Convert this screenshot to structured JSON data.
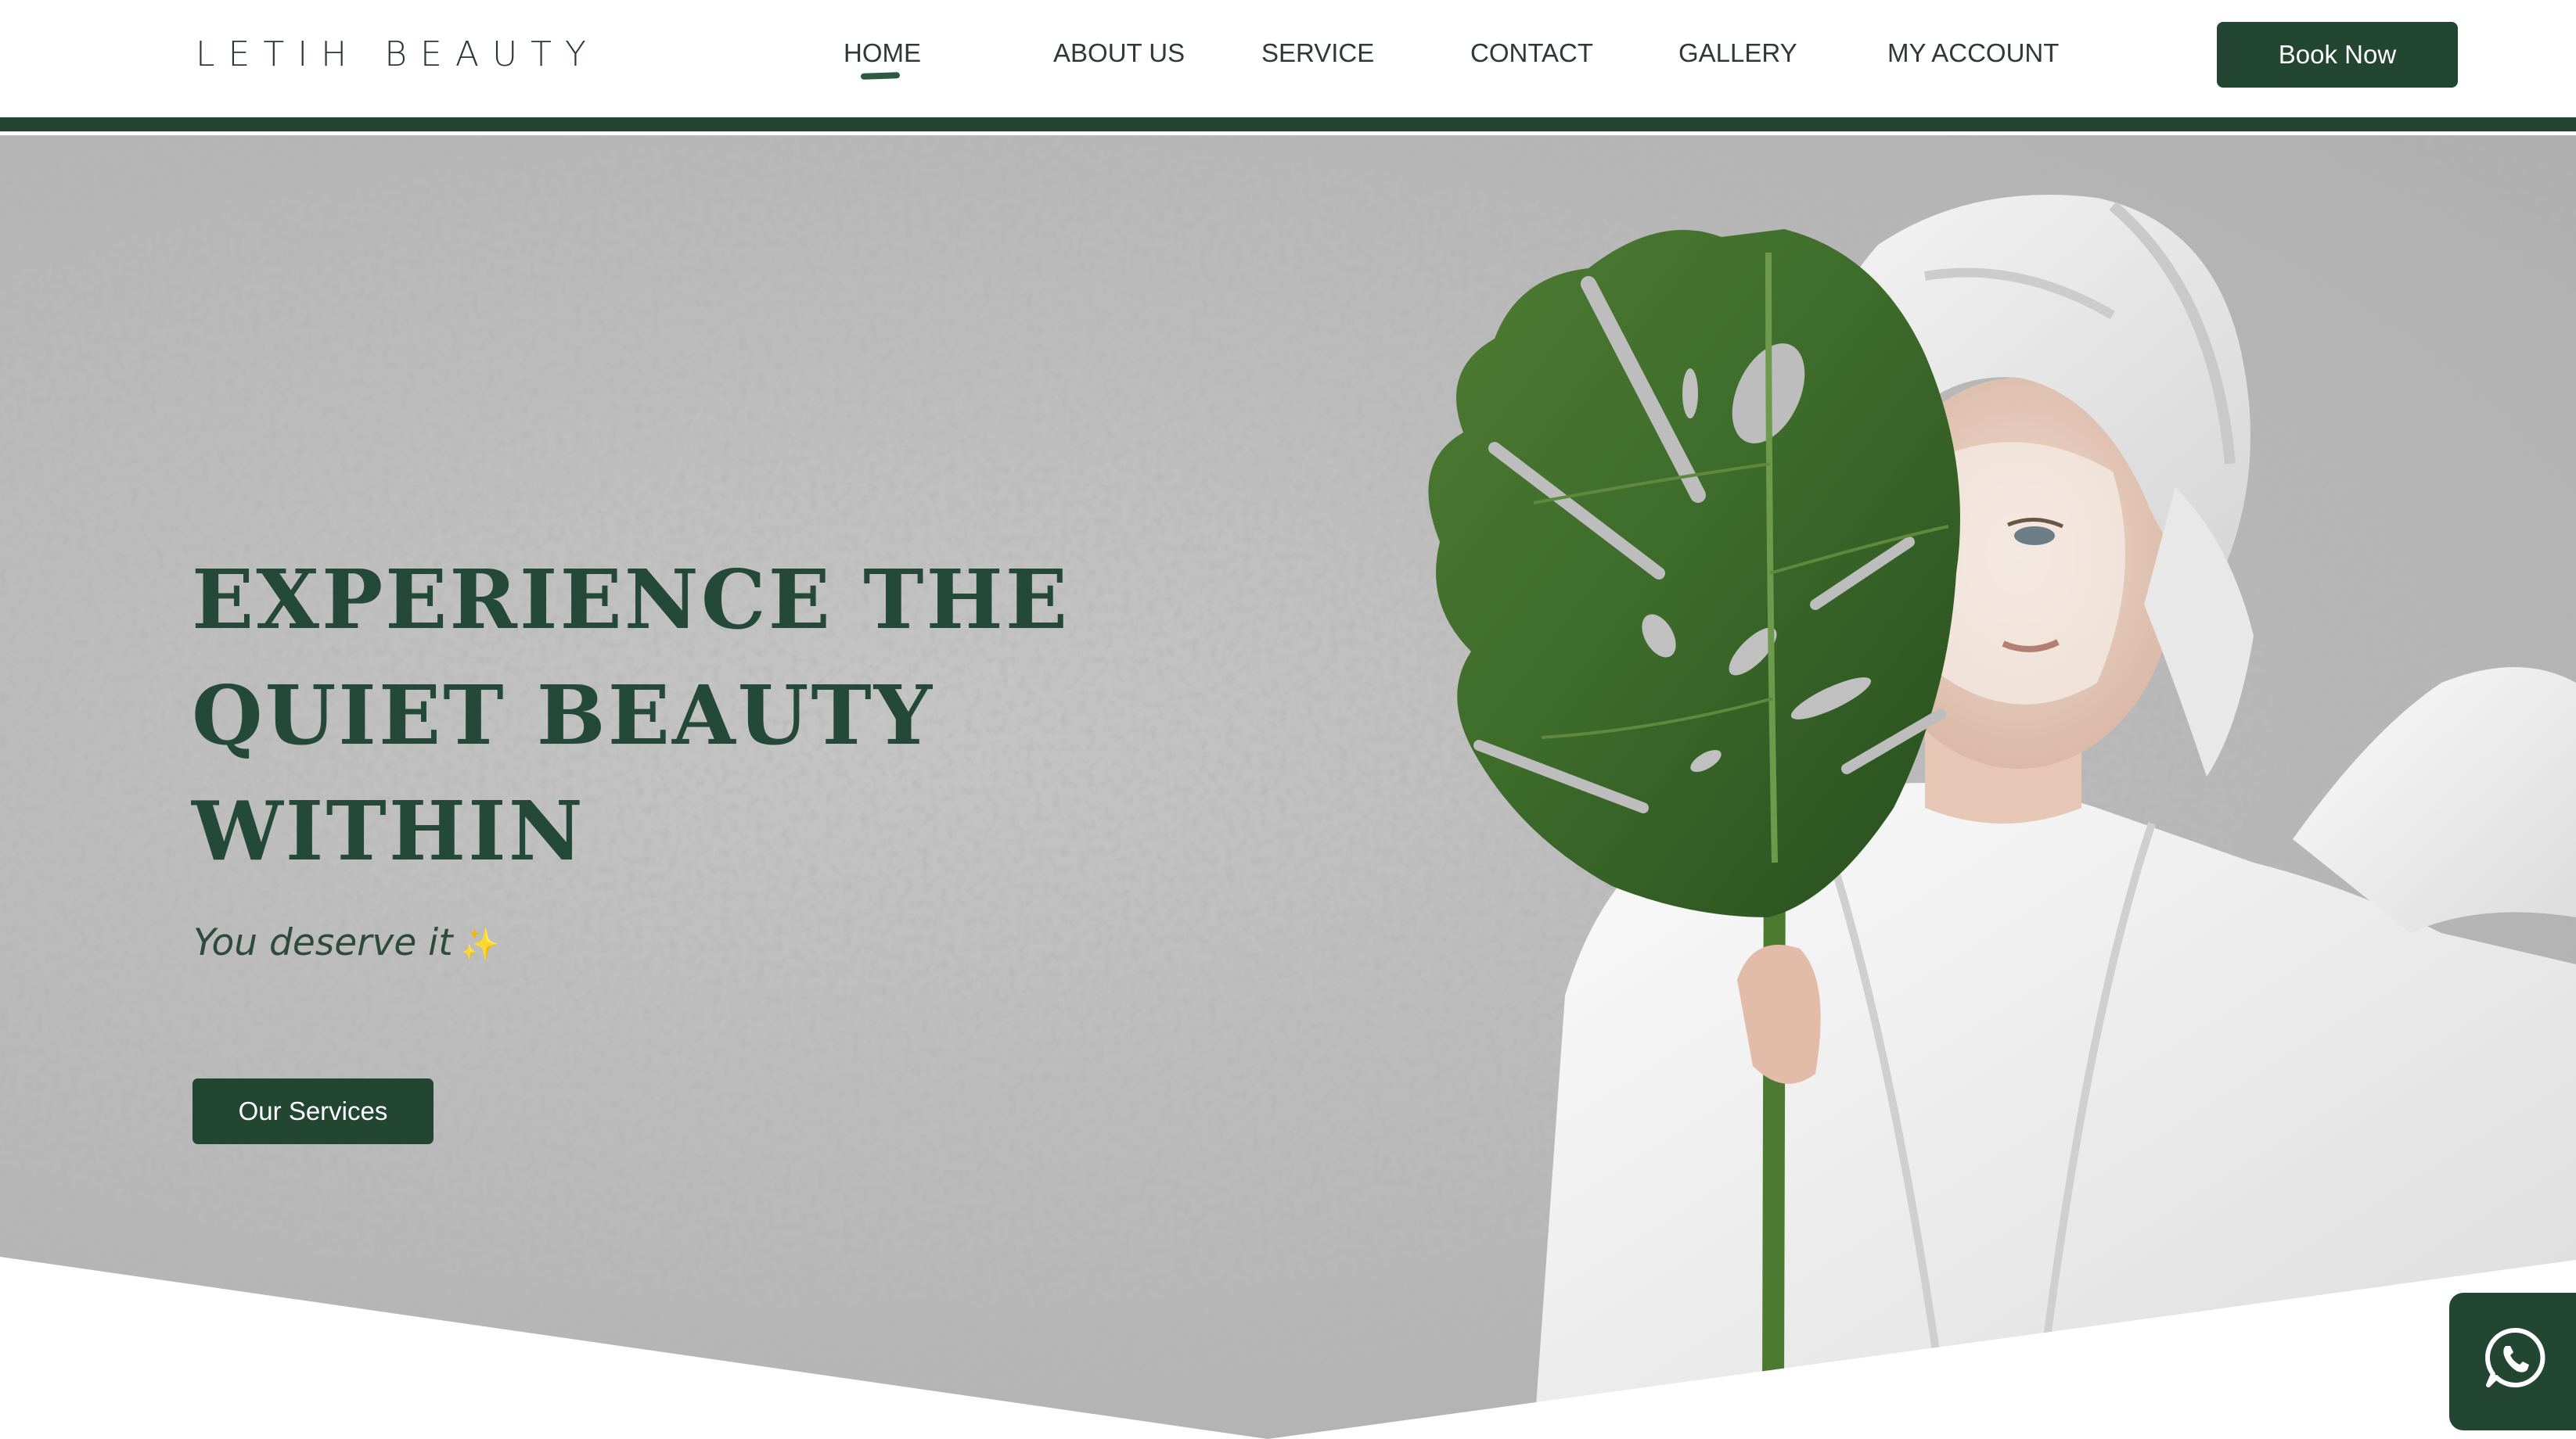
{
  "header": {
    "logo": "LETIH BEAUTY",
    "nav": [
      {
        "label": "HOME",
        "active": true
      },
      {
        "label": "ABOUT US"
      },
      {
        "label": "SERVICE"
      },
      {
        "label": "CONTACT"
      },
      {
        "label": "GALLERY"
      },
      {
        "label": "MY ACCOUNT"
      }
    ],
    "book_button": "Book Now"
  },
  "hero": {
    "title_lines": [
      "EXPERIENCE THE",
      "QUIET BEAUTY",
      "WITHIN"
    ],
    "tagline": "You deserve it",
    "tagline_emoji": "✨",
    "cta_button": "Our Services"
  },
  "floating": {
    "whatsapp_icon": "whatsapp-icon"
  },
  "colors": {
    "brand_green": "#234632",
    "title_green": "#24493a",
    "leaf_green": "#3f6a2c",
    "sparkle": "#e8c24a"
  }
}
